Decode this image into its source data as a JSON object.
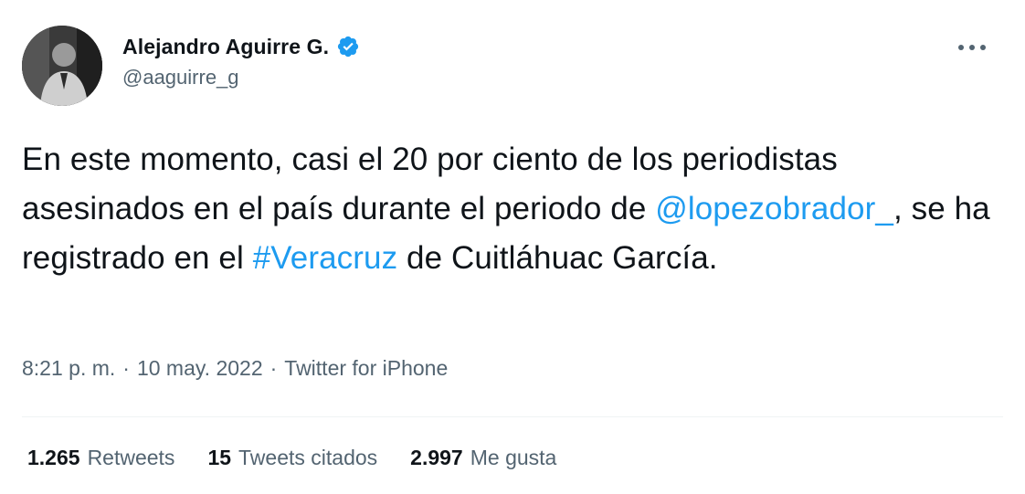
{
  "author": {
    "display_name": "Alejandro Aguirre G.",
    "handle": "@aaguirre_g",
    "verified": true,
    "avatar_icon": "person-photo-avatar"
  },
  "menu": {
    "icon": "more-horizontal-icon"
  },
  "tweet": {
    "text_part1": "En este momento, casi el 20 por ciento de los periodistas asesinados en el país durante el periodo de ",
    "mention": "@lopezobrador_",
    "text_part2": ", se ha registrado en el ",
    "hashtag": "#Veracruz",
    "text_part3": " de Cuitláhuac García."
  },
  "meta": {
    "time": "8:21 p. m.",
    "separator1": "·",
    "date": "10 may. 2022",
    "separator2": "·",
    "source": "Twitter for iPhone"
  },
  "stats": {
    "retweets": {
      "count": "1.265",
      "label": "Retweets"
    },
    "quotes": {
      "count": "15",
      "label": "Tweets citados"
    },
    "likes": {
      "count": "2.997",
      "label": "Me gusta"
    }
  },
  "colors": {
    "link": "#1d9bf0",
    "text": "#0f1419",
    "secondary": "#536471",
    "verified": "#1d9bf0"
  }
}
